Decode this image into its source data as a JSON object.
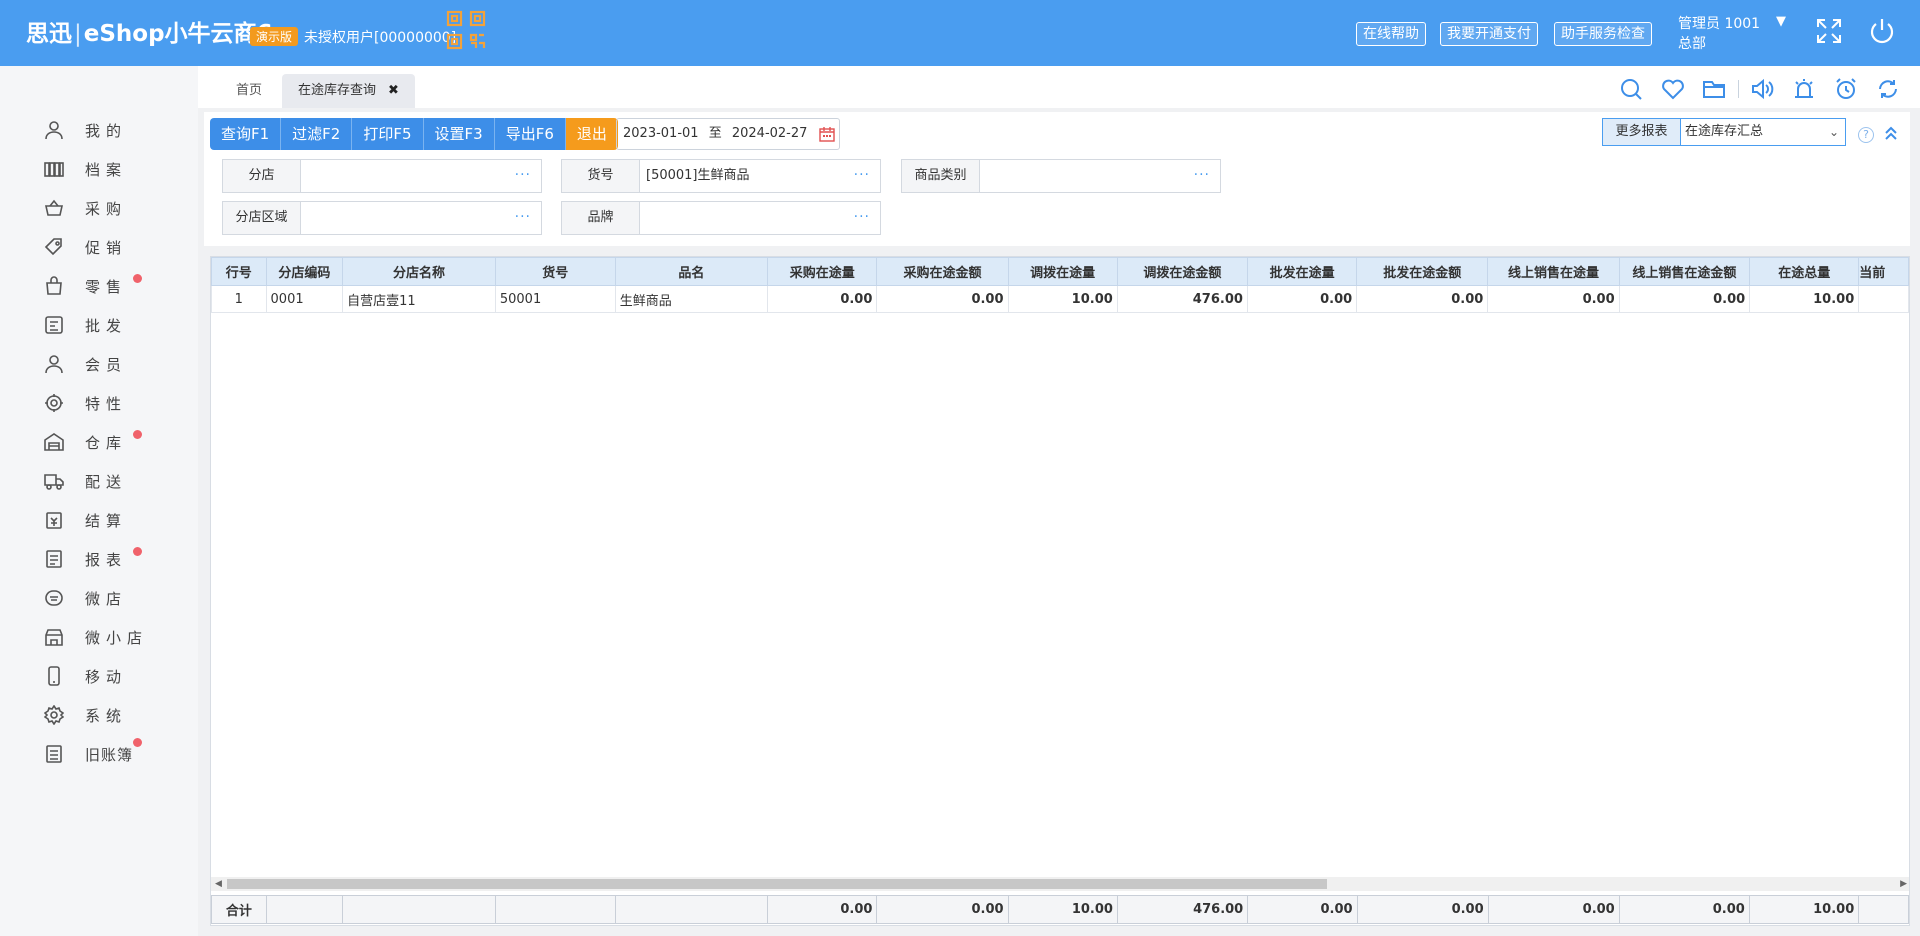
{
  "header": {
    "brand_cn": "思迅",
    "brand_product": "eShop小牛云商6",
    "demo_badge": "演示版",
    "user_status": "未授权用户[00000000]",
    "buttons": [
      "在线帮助",
      "我要开通支付",
      "助手服务检查"
    ],
    "user_line1": "管理员 1001",
    "user_line2": "总部",
    "caret": "▼"
  },
  "sidebar": {
    "items": [
      {
        "label": "我的",
        "icon": "user-icon",
        "dot": false
      },
      {
        "label": "档案",
        "icon": "archive-icon",
        "dot": false
      },
      {
        "label": "采购",
        "icon": "basket-icon",
        "dot": false
      },
      {
        "label": "促销",
        "icon": "tag-icon",
        "dot": false
      },
      {
        "label": "零售",
        "icon": "shopping-bag-icon",
        "dot": true
      },
      {
        "label": "批发",
        "icon": "wholesale-icon",
        "dot": false
      },
      {
        "label": "会员",
        "icon": "member-icon",
        "dot": false
      },
      {
        "label": "特性",
        "icon": "feature-icon",
        "dot": false
      },
      {
        "label": "仓库",
        "icon": "warehouse-icon",
        "dot": true
      },
      {
        "label": "配送",
        "icon": "truck-icon",
        "dot": false
      },
      {
        "label": "结算",
        "icon": "settlement-icon",
        "dot": false
      },
      {
        "label": "报表",
        "icon": "report-icon",
        "dot": true
      },
      {
        "label": "微店",
        "icon": "micro-shop-icon",
        "dot": false
      },
      {
        "label": "微小店",
        "icon": "mini-shop-icon",
        "dot": false
      },
      {
        "label": "移动",
        "icon": "mobile-icon",
        "dot": false
      },
      {
        "label": "系统",
        "icon": "gear-icon",
        "dot": false
      },
      {
        "label": "旧账簿",
        "icon": "ledger-icon",
        "dot": true
      }
    ]
  },
  "tabs": {
    "home": "首页",
    "active": "在途库存查询",
    "close": "✖"
  },
  "toolbar": {
    "query": "查询F1",
    "filter": "过滤F2",
    "print": "打印F5",
    "settings": "设置F3",
    "export": "导出F6",
    "exit": "退出",
    "date_from": "2023-01-01",
    "date_to_sep": "至",
    "date_to": "2024-02-27",
    "more_reports_label": "更多报表",
    "more_reports_value": "在途库存汇总",
    "help": "?"
  },
  "filters": {
    "branch_label": "分店",
    "branch_value": "",
    "item_label": "货号",
    "item_value": "[50001]生鲜商品",
    "category_label": "商品类别",
    "category_value": "",
    "region_label": "分店区域",
    "region_value": "",
    "brand_label": "品牌",
    "brand_value": "",
    "dots": "···"
  },
  "table": {
    "columns": [
      "行号",
      "分店编码",
      "分店名称",
      "货号",
      "品名",
      "采购在途量",
      "采购在途金额",
      "调拨在途量",
      "调拨在途金额",
      "批发在途量",
      "批发在途金额",
      "线上销售在途量",
      "线上销售在途金额",
      "在途总量",
      "当前"
    ],
    "rows": [
      [
        "1",
        "0001",
        "自营店壹11",
        "50001",
        "生鲜商品",
        "0.00",
        "0.00",
        "10.00",
        "476.00",
        "0.00",
        "0.00",
        "0.00",
        "0.00",
        "10.00",
        ""
      ]
    ],
    "footer": [
      "合计",
      "",
      "",
      "",
      "",
      "0.00",
      "0.00",
      "10.00",
      "476.00",
      "0.00",
      "0.00",
      "0.00",
      "0.00",
      "10.00",
      ""
    ]
  },
  "colors": {
    "header_bg": "#4a9df0",
    "primary_button": "#3d8ee8",
    "exit_button": "#f59b1c",
    "badge": "#f39a1e",
    "notify_dot": "#f0626b"
  }
}
